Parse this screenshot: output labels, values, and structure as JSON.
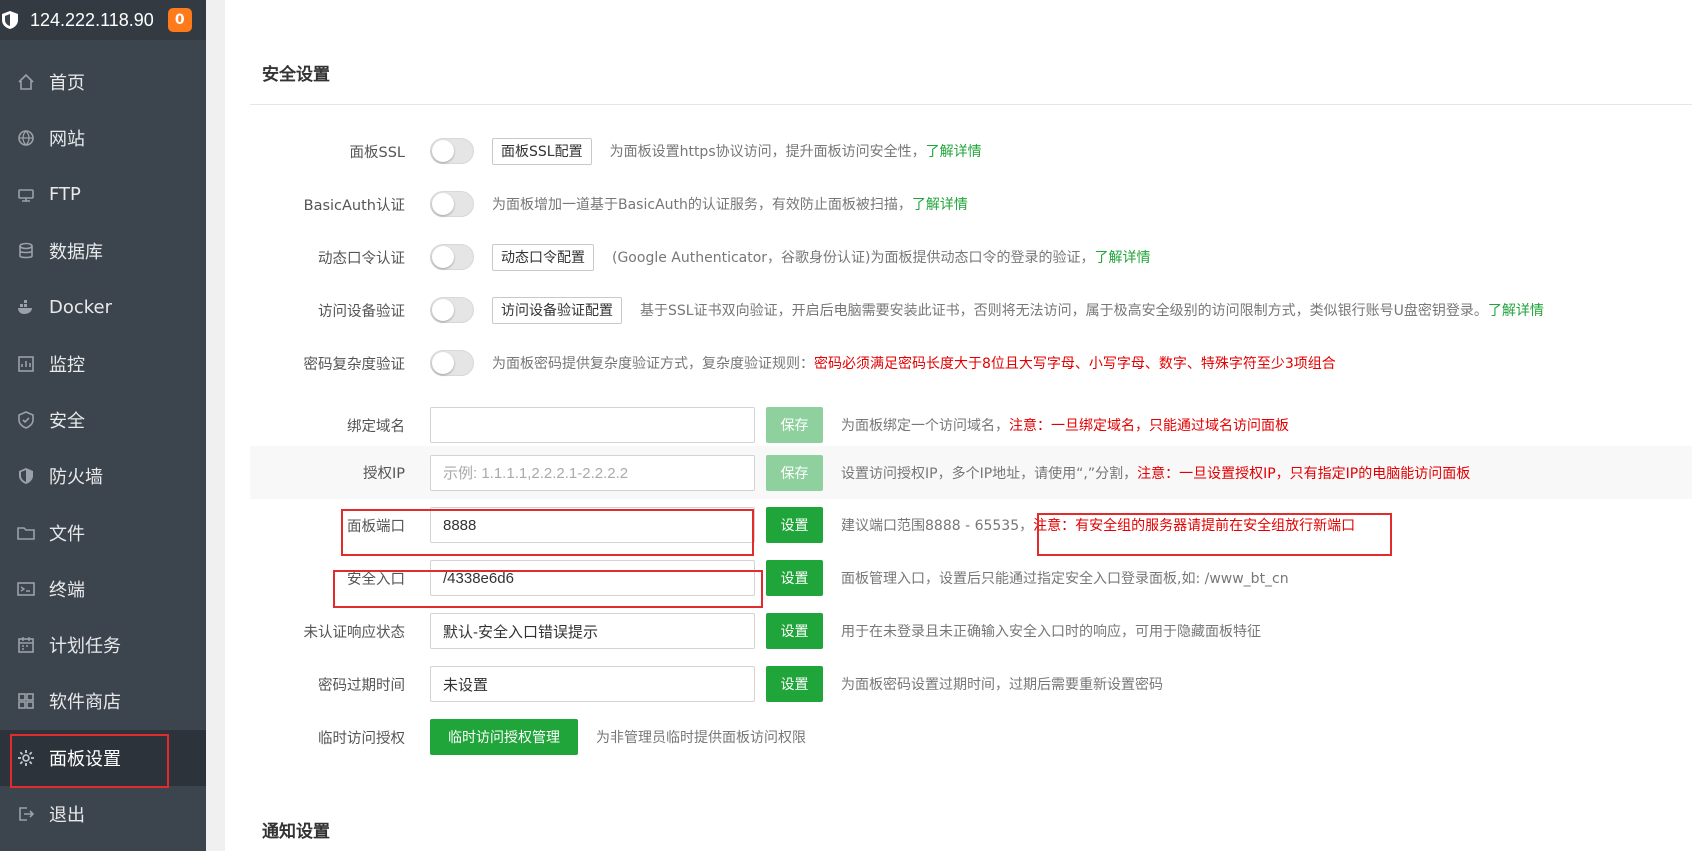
{
  "server": {
    "ip": "124.222.118.90",
    "badge": "0"
  },
  "sidebar": {
    "items": [
      {
        "label": "首页",
        "icon": "home-icon"
      },
      {
        "label": "网站",
        "icon": "globe-icon"
      },
      {
        "label": "FTP",
        "icon": "ftp-icon"
      },
      {
        "label": "数据库",
        "icon": "database-icon"
      },
      {
        "label": "Docker",
        "icon": "docker-icon"
      },
      {
        "label": "监控",
        "icon": "monitor-icon"
      },
      {
        "label": "安全",
        "icon": "shield-check-icon"
      },
      {
        "label": "防火墙",
        "icon": "firewall-icon"
      },
      {
        "label": "文件",
        "icon": "folder-icon"
      },
      {
        "label": "终端",
        "icon": "terminal-icon"
      },
      {
        "label": "计划任务",
        "icon": "calendar-icon"
      },
      {
        "label": "软件商店",
        "icon": "apps-icon"
      },
      {
        "label": "面板设置",
        "icon": "gear-icon",
        "active": true
      },
      {
        "label": "退出",
        "icon": "logout-icon"
      }
    ]
  },
  "security": {
    "title": "安全设置",
    "ssl": {
      "label": "面板SSL",
      "button": "面板SSL配置",
      "desc": "为面板设置https协议访问，提升面板访问安全性，",
      "link": "了解详情"
    },
    "basicauth": {
      "label": "BasicAuth认证",
      "desc": "为面板增加一道基于BasicAuth的认证服务，有效防止面板被扫描，",
      "link": "了解详情"
    },
    "otp": {
      "label": "动态口令认证",
      "button": "动态口令配置",
      "desc": "(Google Authenticator，谷歌身份认证)为面板提供动态口令的登录的验证，",
      "link": "了解详情"
    },
    "device": {
      "label": "访问设备验证",
      "button": "访问设备验证配置",
      "desc": "基于SSL证书双向验证，开启后电脑需要安装此证书，否则将无法访问，属于极高安全级别的访问限制方式，类似银行账号U盘密钥登录。",
      "link": "了解详情"
    },
    "pwdcomplex": {
      "label": "密码复杂度验证",
      "desc": "为面板密码提供复杂度验证方式，复杂度验证规则：",
      "warn": "密码必须满足密码长度大于8位且大写字母、小写字母、数字、特殊字符至少3项组合"
    },
    "domain": {
      "label": "绑定域名",
      "value": "",
      "button": "保存",
      "desc": "为面板绑定一个访问域名，",
      "warn": "注意：一旦绑定域名，只能通过域名访问面板"
    },
    "authip": {
      "label": "授权IP",
      "placeholder": "示例: 1.1.1.1,2.2.2.1-2.2.2.2",
      "button": "保存",
      "desc": "设置访问授权IP，多个IP地址，请使用“,”分割，",
      "warn": "注意：一旦设置授权IP，只有指定IP的电脑能访问面板"
    },
    "port": {
      "label": "面板端口",
      "value": "8888",
      "button": "设置",
      "desc": "建议端口范围8888 - 65535，",
      "warn": "注意：有安全组的服务器请提前在安全组放行新端口"
    },
    "entry": {
      "label": "安全入口",
      "value": "/4338e6d6",
      "button": "设置",
      "desc": "面板管理入口，设置后只能通过指定安全入口登录面板,如: /www_bt_cn"
    },
    "unauth": {
      "label": "未认证响应状态",
      "value": "默认-安全入口错误提示",
      "button": "设置",
      "desc": "用于在未登录且未正确输入安全入口时的响应，可用于隐藏面板特征"
    },
    "pwdexpire": {
      "label": "密码过期时间",
      "value": "未设置",
      "button": "设置",
      "desc": "为面板密码设置过期时间，过期后需要重新设置密码"
    },
    "tempauth": {
      "label": "临时访问授权",
      "button": "临时访问授权管理",
      "desc": "为非管理员临时提供面板访问权限"
    }
  },
  "notify": {
    "title": "通知设置"
  },
  "colors": {
    "accent": "#20a53a",
    "warn": "#e40000",
    "sidebar": "#3c444d",
    "badge": "#ff7a1a"
  }
}
